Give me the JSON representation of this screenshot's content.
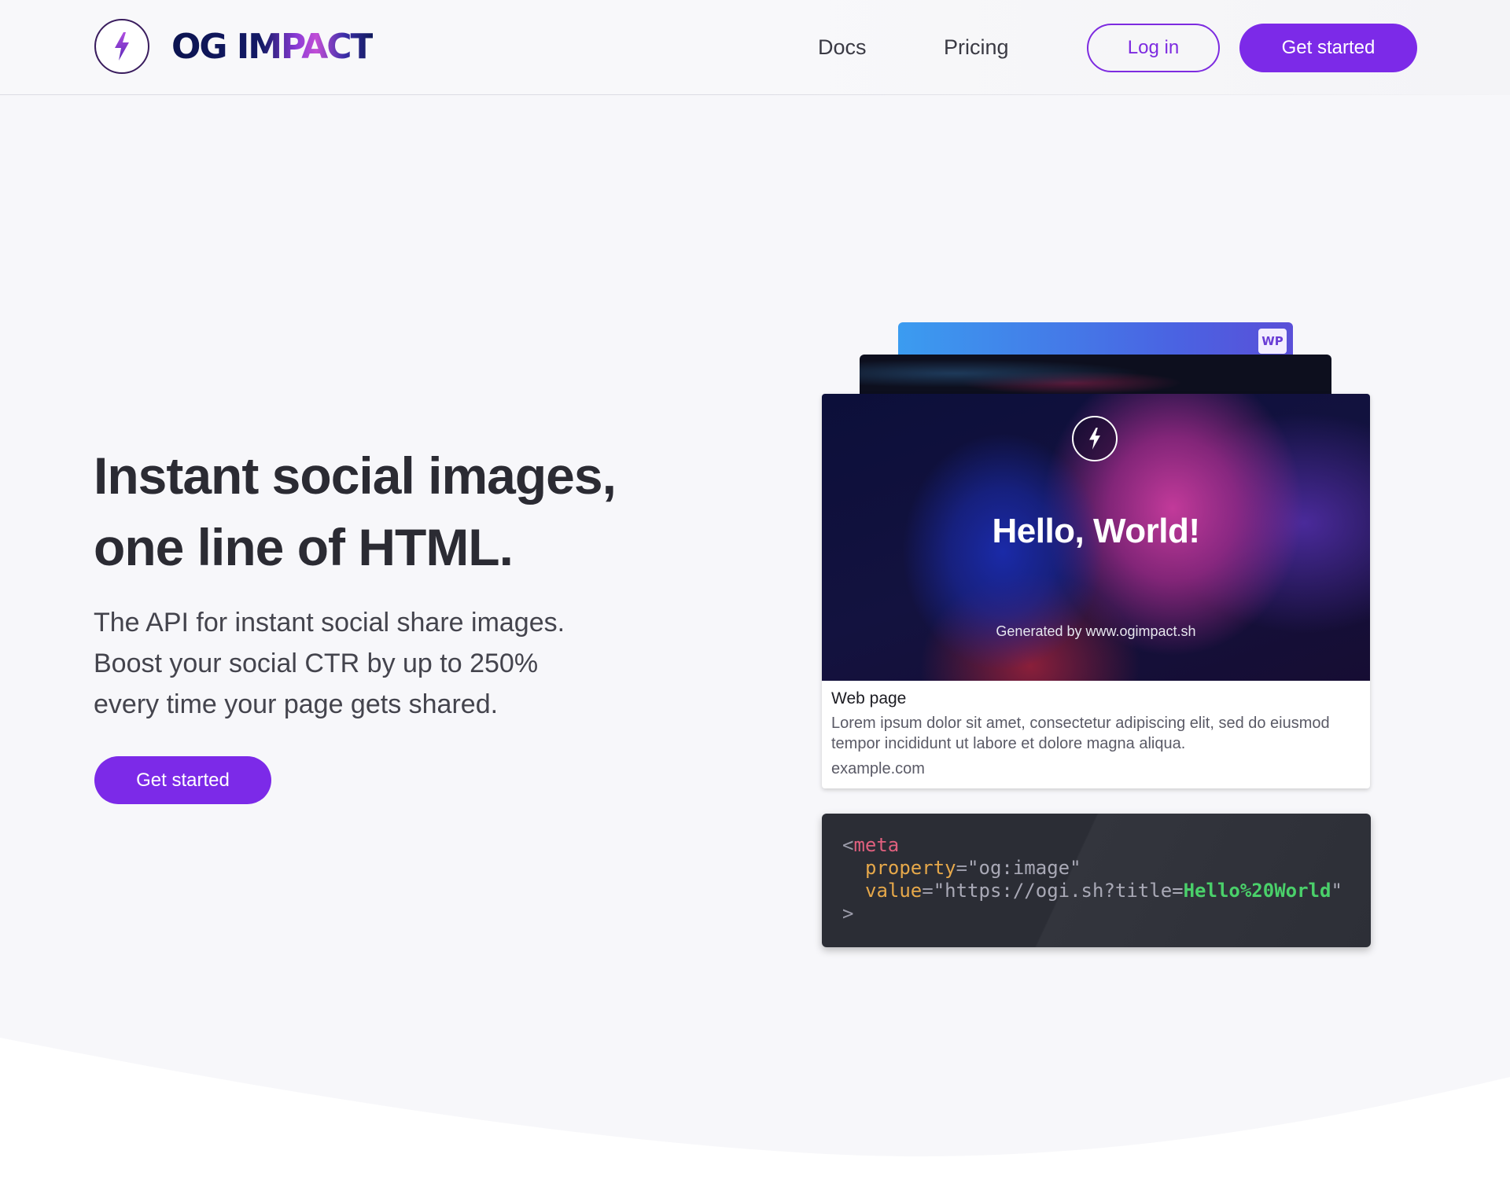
{
  "header": {
    "brand_name": "OG IMPACT",
    "nav": [
      {
        "label": "Docs"
      },
      {
        "label": "Pricing"
      }
    ],
    "login_label": "Log in",
    "cta_label": "Get started"
  },
  "hero": {
    "headline_line1": "Instant social images,",
    "headline_line2": "one line of HTML.",
    "subtext_line1": "The API for instant social share images.",
    "subtext_line2": "Boost your social CTR by up to 250%",
    "subtext_line3": "every time your page gets shared.",
    "cta_label": "Get started"
  },
  "preview": {
    "badge_text": "WP",
    "image_title": "Hello, World!",
    "image_credit": "Generated by www.ogimpact.sh",
    "card_title": "Web page",
    "card_description": "Lorem ipsum dolor sit amet, consectetur adipiscing elit, sed do eiusmod tempor incididunt ut labore et dolore magna aliqua.",
    "card_url": "example.com"
  },
  "code": {
    "open_bracket": "<",
    "tag": "meta",
    "attr1": "property",
    "val1": "\"og:image\"",
    "attr2": "value",
    "val2_prefix": "\"https://ogi.sh?title=",
    "val2_highlight": "Hello%20World",
    "val2_suffix": "\"",
    "close_bracket": ">",
    "equals": "="
  },
  "colors": {
    "accent": "#7c2ae8",
    "background": "#f7f7fa",
    "code_bg": "#2b2d35"
  },
  "icons": {
    "logo": "lightning-bolt-icon"
  }
}
